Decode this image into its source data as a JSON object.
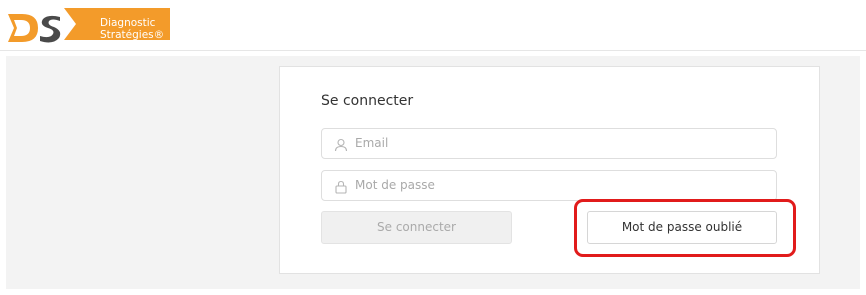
{
  "header": {
    "brand_line1": "Diagnostic",
    "brand_line2": "Stratégies®",
    "brand_color": "#f39b2a"
  },
  "login": {
    "title": "Se connecter",
    "email_placeholder": "Email",
    "password_placeholder": "Mot de passe",
    "submit_label": "Se connecter",
    "forgot_label": "Mot de passe oublié"
  },
  "annotation": {
    "highlight_color": "#e11b1b"
  },
  "icons": {
    "email": "user-icon",
    "password": "lock-icon"
  }
}
